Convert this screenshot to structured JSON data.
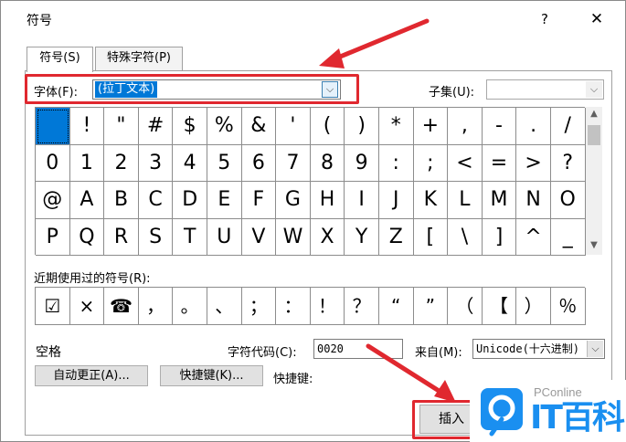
{
  "window": {
    "title": "符号",
    "help_label": "?",
    "close_label": "✕"
  },
  "tabs": [
    {
      "label": "符号(S)",
      "active": true
    },
    {
      "label": "特殊字符(P)",
      "active": false
    }
  ],
  "font": {
    "label": "字体(F):",
    "value": "(拉丁文本)",
    "arrow": "⌵"
  },
  "subset": {
    "label": "子集(U):",
    "value": "",
    "arrow": "⌵"
  },
  "symbol_grid": {
    "selected_index": 0,
    "rows": [
      [
        " ",
        "!",
        "\"",
        "#",
        "$",
        "%",
        "&",
        "'",
        "(",
        ")",
        "*",
        "+",
        ",",
        "-",
        ".",
        "/"
      ],
      [
        "0",
        "1",
        "2",
        "3",
        "4",
        "5",
        "6",
        "7",
        "8",
        "9",
        ":",
        ";",
        "<",
        "=",
        ">",
        "?"
      ],
      [
        "@",
        "A",
        "B",
        "C",
        "D",
        "E",
        "F",
        "G",
        "H",
        "I",
        "J",
        "K",
        "L",
        "M",
        "N",
        "O"
      ],
      [
        "P",
        "Q",
        "R",
        "S",
        "T",
        "U",
        "V",
        "W",
        "X",
        "Y",
        "Z",
        "[",
        "\\",
        "]",
        "^",
        "_"
      ]
    ]
  },
  "recent": {
    "label": "近期使用过的符号(R):",
    "symbols": [
      "☑",
      "×",
      "☎",
      "，",
      "。",
      "、",
      "；",
      "：",
      "！",
      "？",
      "“",
      "”",
      "（",
      "【",
      "）",
      "％"
    ]
  },
  "info": {
    "char_name": "空格",
    "code_label": "字符代码(C):",
    "code_value": "0020",
    "from_label": "来自(M):",
    "from_value": "Unicode(十六进制)",
    "from_arrow": "⌵"
  },
  "buttons": {
    "autocorrect": "自动更正(A)...",
    "shortcut_key": "快捷键(K)...",
    "shortcut_label": "快捷键:",
    "insert": "插入"
  },
  "watermark": {
    "pconline": "PConline",
    "brand": "IT百科"
  },
  "colors": {
    "selection": "#0078d7",
    "annotation_red": "#e0282f",
    "brand_blue": "#1a8ff0"
  }
}
